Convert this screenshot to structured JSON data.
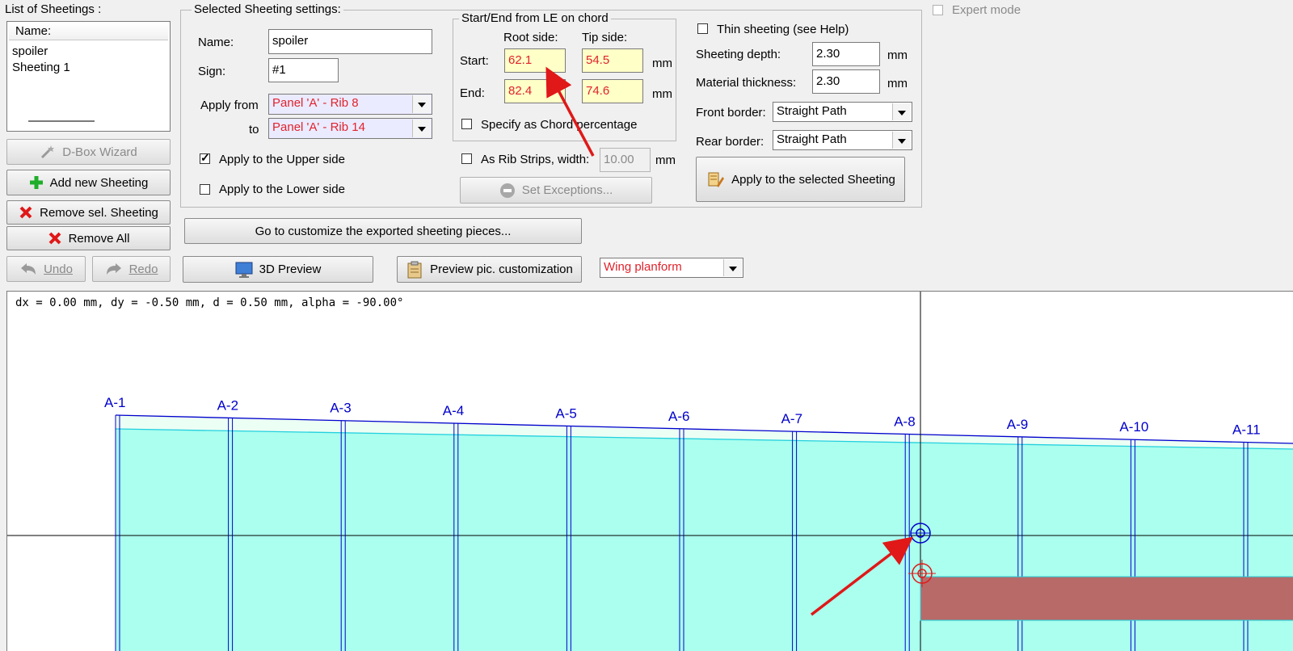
{
  "sheetings_list": {
    "title": "List of Sheetings :",
    "column_header": "Name:",
    "items": [
      "spoiler",
      "Sheeting 1"
    ]
  },
  "left_buttons": {
    "dbox_wizard": "D-Box Wizard",
    "add_new": "Add new Sheeting",
    "remove_sel": "Remove sel. Sheeting",
    "remove_all": "Remove All",
    "undo": "Undo",
    "redo": "Redo"
  },
  "settings": {
    "title": "Selected Sheeting settings:",
    "name_label": "Name:",
    "name_value": "spoiler",
    "sign_label": "Sign:",
    "sign_value": "#1",
    "apply_from_label": "Apply from",
    "apply_from_value": "Panel 'A' - Rib 8",
    "to_label": "to",
    "apply_to_value": "Panel 'A' - Rib 14",
    "upper_side_label": "Apply to the Upper side",
    "lower_side_label": "Apply to the Lower side",
    "upper_side_checked": true,
    "lower_side_checked": false
  },
  "chord": {
    "title": "Start/End from LE on chord",
    "root_label": "Root side:",
    "tip_label": "Tip side:",
    "start_label": "Start:",
    "end_label": "End:",
    "start_root": "62.1",
    "start_tip": "54.5",
    "end_root": "82.4",
    "end_tip": "74.6",
    "unit": "mm",
    "chord_pct_label": "Specify as Chord percentage",
    "rib_strips_label": "As Rib Strips, width:",
    "rib_strips_value": "10.00",
    "set_exceptions": "Set Exceptions..."
  },
  "right_settings": {
    "thin_label": "Thin sheeting (see Help)",
    "depth_label": "Sheeting depth:",
    "depth_value": "2.30",
    "thickness_label": "Material thickness:",
    "thickness_value": "2.30",
    "unit": "mm",
    "front_border_label": "Front border:",
    "front_border_value": "Straight Path",
    "rear_border_label": "Rear border:",
    "rear_border_value": "Straight Path",
    "apply_button": "Apply to the selected Sheeting"
  },
  "expert_mode_label": "Expert mode",
  "toolbar": {
    "customize_button": "Go to customize the exported sheeting pieces...",
    "preview_3d": "3D Preview",
    "preview_pic": "Preview pic. customization",
    "view_select": "Wing planform"
  },
  "canvas": {
    "coords_text": "dx = 0.00 mm, dy = -0.50 mm, d = 0.50 mm, alpha = -90.00°",
    "ribs": [
      "A-1",
      "A-2",
      "A-3",
      "A-4",
      "A-5",
      "A-6",
      "A-7",
      "A-8",
      "A-9",
      "A-10",
      "A-11"
    ],
    "colors": {
      "wing_fill": "#aaffee",
      "sheeting_fill": "#b86a68",
      "rib_line": "#0000cc",
      "arrow": "#e01818"
    }
  }
}
